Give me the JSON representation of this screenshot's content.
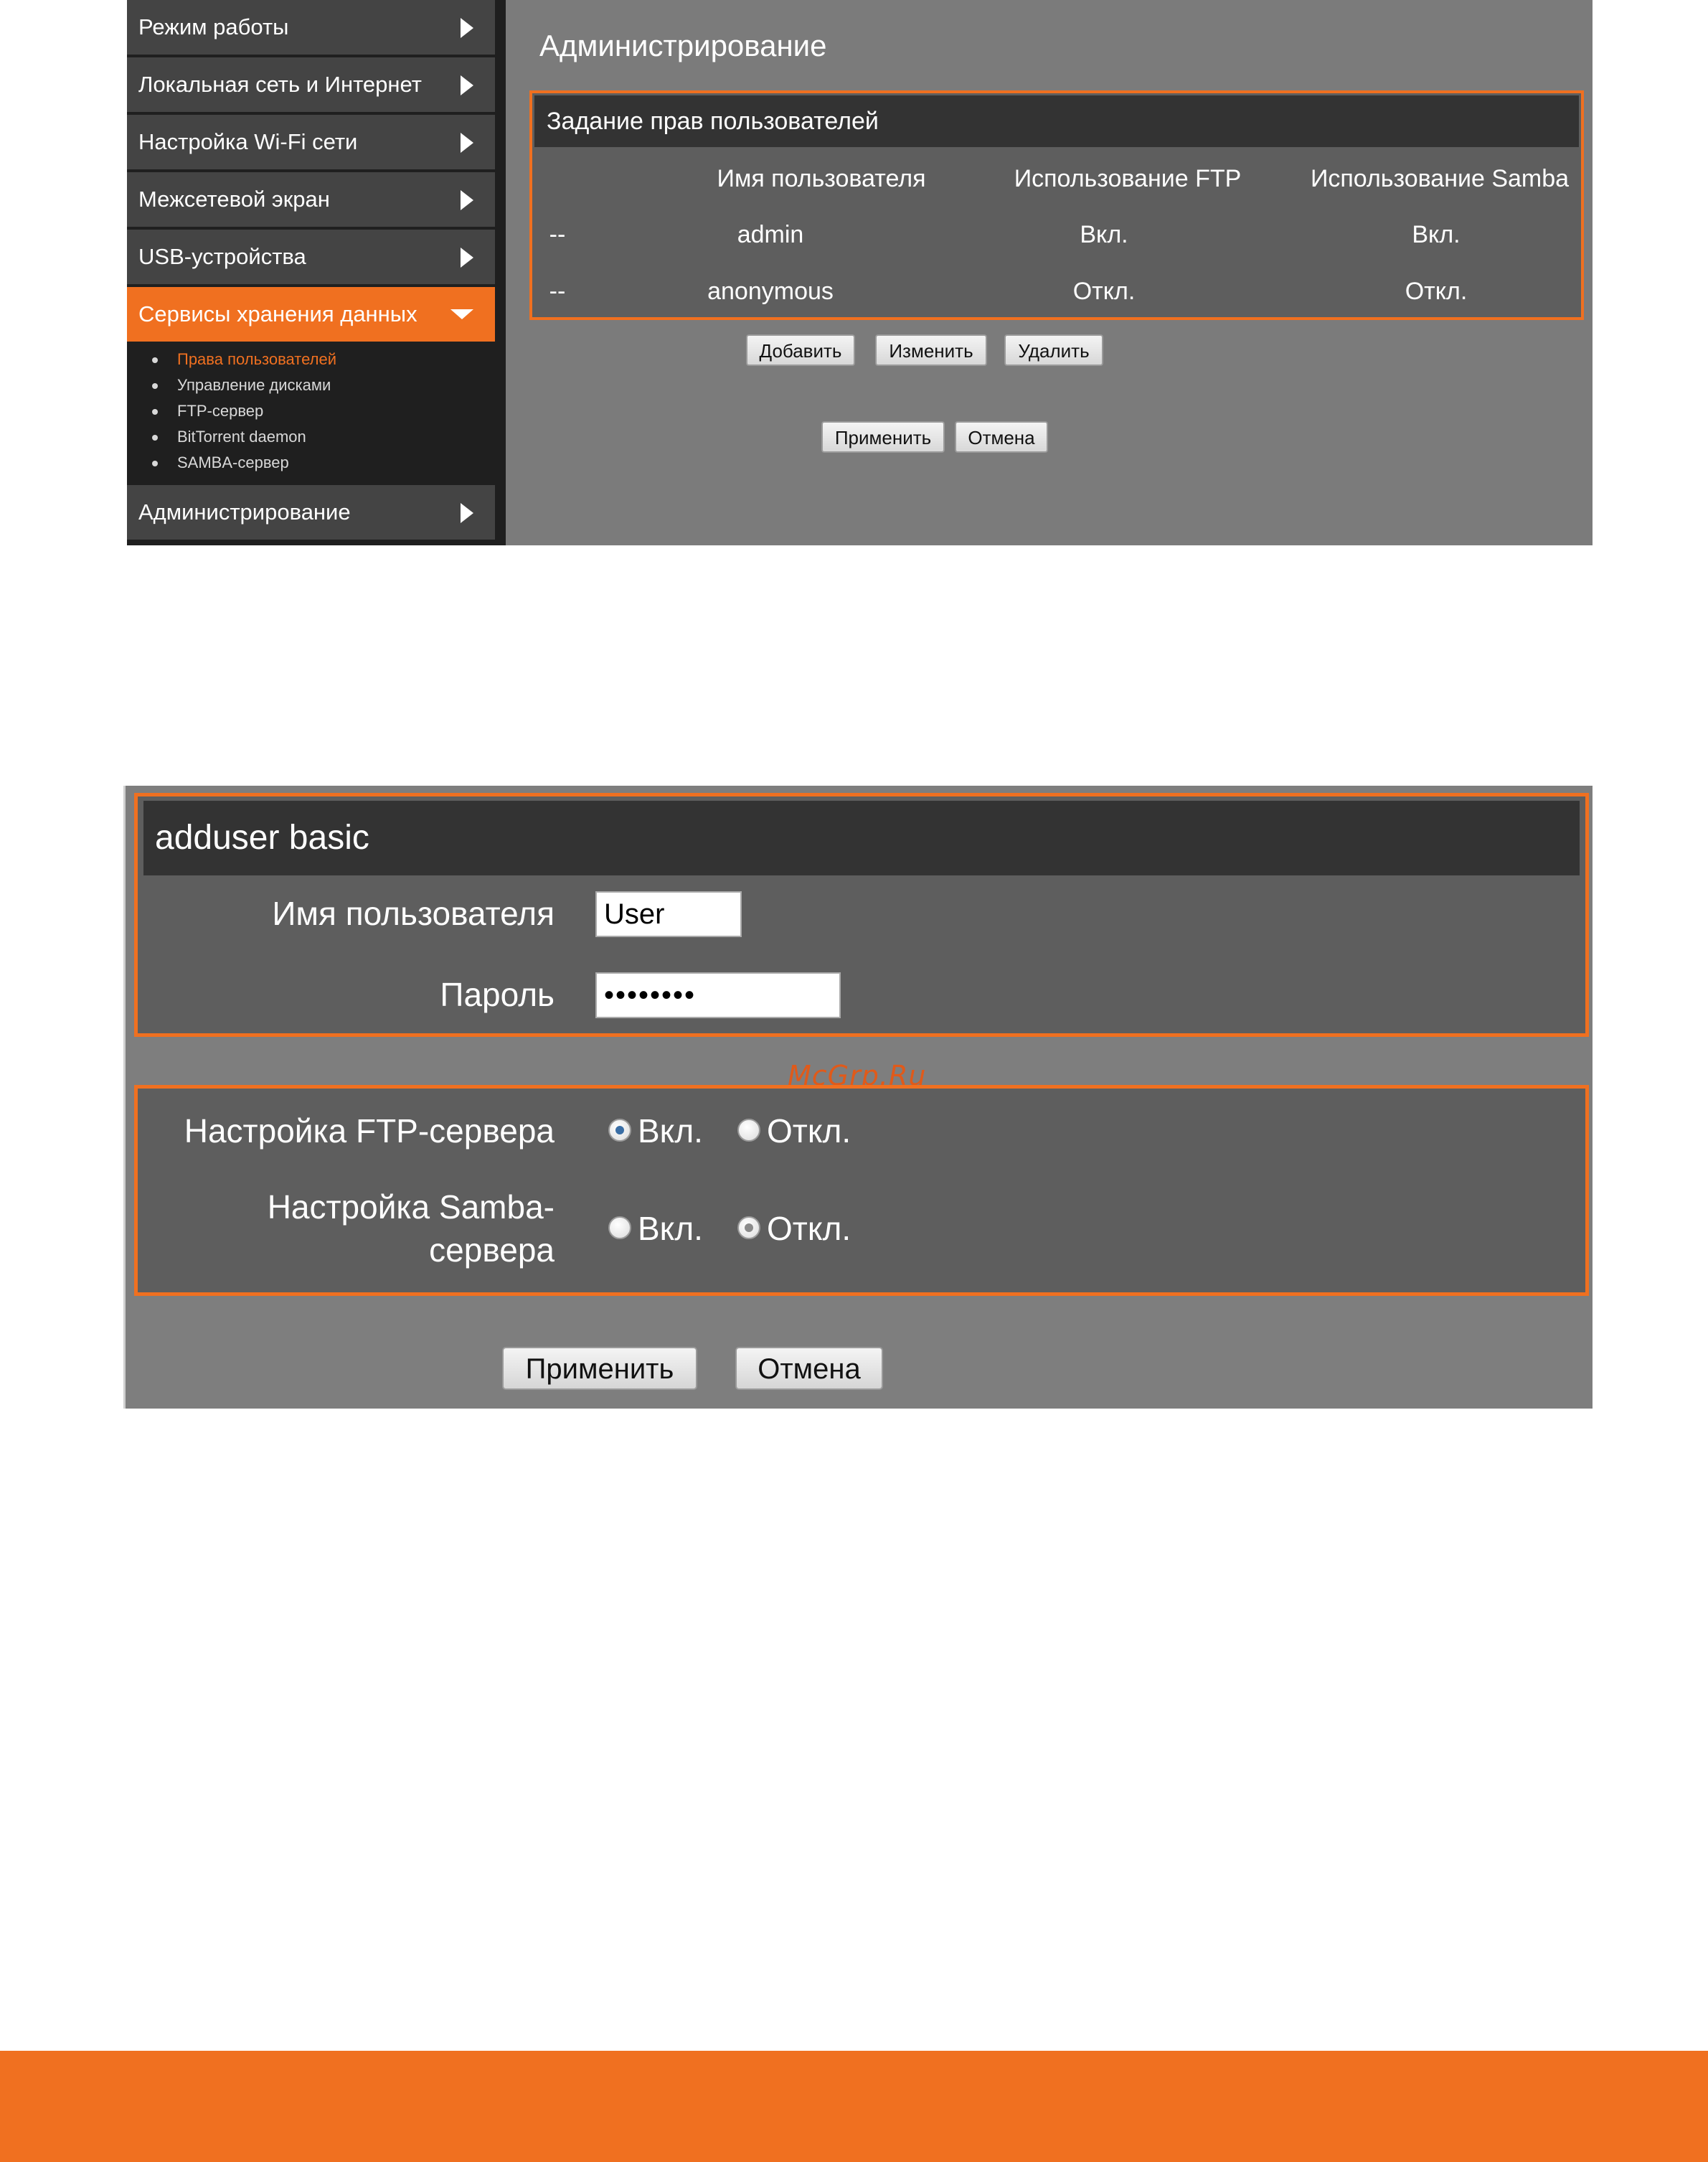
{
  "shot1": {
    "sidebar": {
      "items": [
        {
          "label": "Режим работы"
        },
        {
          "label": "Локальная сеть и Интернет"
        },
        {
          "label": "Настройка Wi-Fi сети"
        },
        {
          "label": "Межсетевой экран"
        },
        {
          "label": "USB-устройства"
        },
        {
          "label": "Сервисы хранения данных",
          "active": true
        },
        {
          "label": "Администрирование"
        }
      ],
      "subitems": [
        {
          "label": "Права пользователей",
          "active": true
        },
        {
          "label": "Управление дисками"
        },
        {
          "label": "FTP-сервер"
        },
        {
          "label": "BitTorrent daemon"
        },
        {
          "label": "SAMBA-сервер"
        }
      ]
    },
    "main": {
      "title": "Администрирование",
      "section_title": "Задание прав пользователей",
      "columns": [
        "Имя пользователя",
        "Использование FTP",
        "Использование Samba"
      ],
      "rows": [
        {
          "marker": "--",
          "user": "admin",
          "ftp": "Вкл.",
          "samba": "Вкл."
        },
        {
          "marker": "--",
          "user": "anonymous",
          "ftp": "Откл.",
          "samba": "Откл."
        }
      ],
      "buttons": {
        "add": "Добавить",
        "edit": "Изменить",
        "delete": "Удалить",
        "apply": "Применить",
        "cancel": "Отмена"
      }
    }
  },
  "shot2": {
    "form_title": "adduser basic",
    "username_label": "Имя пользователя",
    "username_value": "User",
    "password_label": "Пароль",
    "password_value": "••••••••",
    "ftp_label": "Настройка FTP-сервера",
    "samba_label_line1": "Настройка Samba-",
    "samba_label_line2": "сервера",
    "on_label": "Вкл.",
    "off_label": "Откл.",
    "ftp_selected": "Вкл.",
    "samba_selected": "Откл.",
    "apply": "Применить",
    "cancel": "Отмена",
    "watermark": "McGrp.Ru"
  },
  "colors": {
    "accent": "#f07020",
    "panel": "#5e5e5e",
    "header": "#333333",
    "background": "#7b7b7b"
  }
}
